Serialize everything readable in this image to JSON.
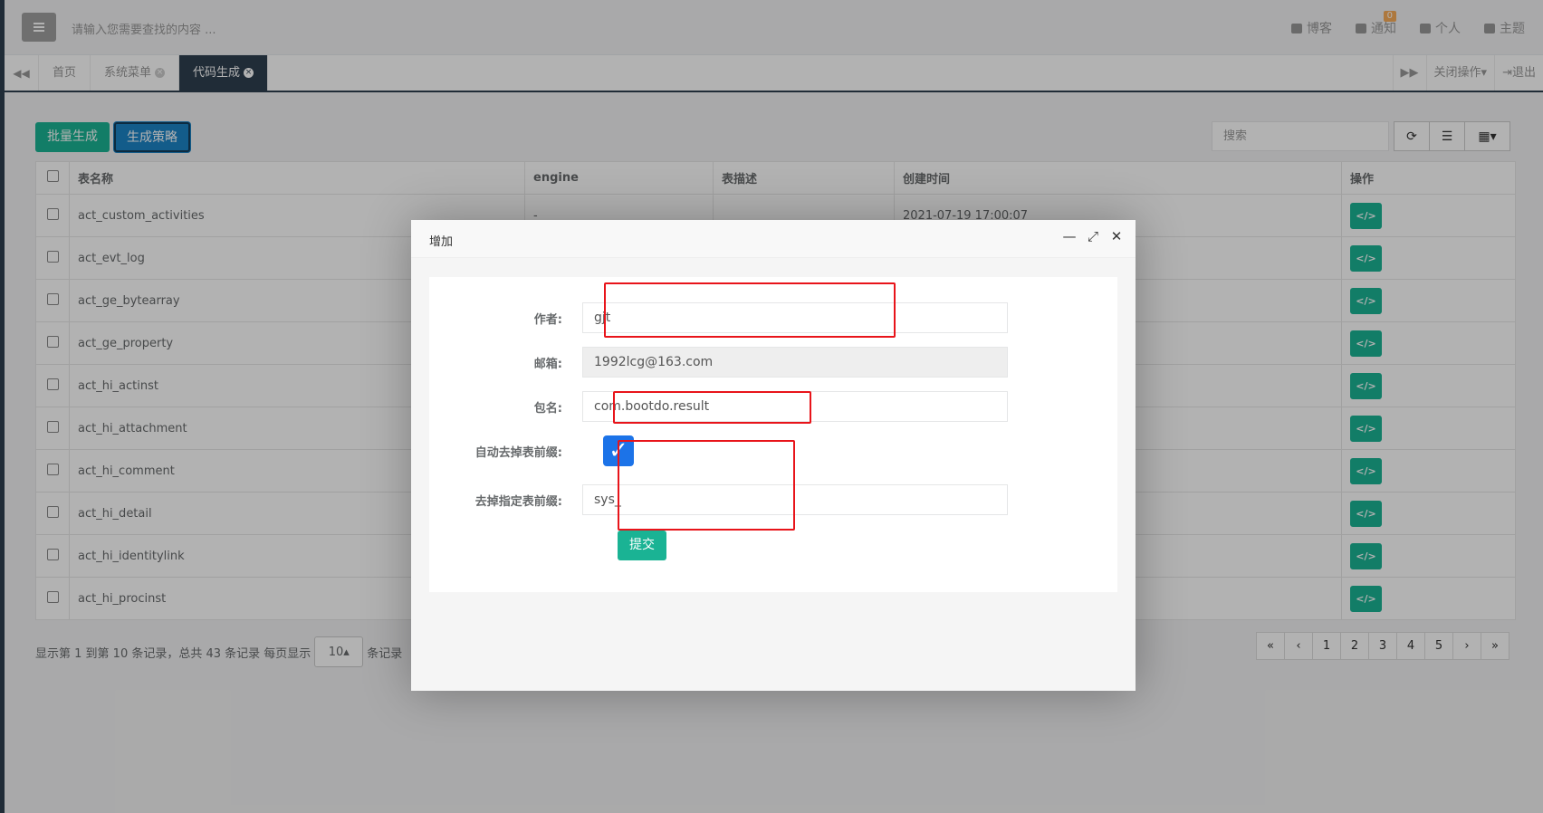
{
  "header": {
    "search_placeholder": "请输入您需要查找的内容 ...",
    "links": [
      {
        "icon": "rss-icon",
        "label": "博客"
      },
      {
        "icon": "envelope-icon",
        "label": "通知",
        "badge": "0"
      },
      {
        "icon": "id-card-icon",
        "label": "个人"
      },
      {
        "icon": "theme-icon",
        "label": "主题"
      }
    ]
  },
  "tabs": {
    "items": [
      {
        "label": "首页"
      },
      {
        "label": "系统菜单"
      },
      {
        "label": "代码生成"
      }
    ],
    "close_ops": "关闭操作",
    "logout": "退出"
  },
  "toolbar": {
    "batch_label": "批量生成",
    "strategy_label": "生成策略",
    "search_placeholder": "搜索"
  },
  "table": {
    "headers": [
      "表名称",
      "engine",
      "表描述",
      "创建时间",
      "操作"
    ],
    "rows": [
      {
        "name": "act_custom_activities",
        "engine": "-",
        "desc": "",
        "created": "2021-07-19 17:00:07"
      },
      {
        "name": "act_evt_log"
      },
      {
        "name": "act_ge_bytearray"
      },
      {
        "name": "act_ge_property"
      },
      {
        "name": "act_hi_actinst"
      },
      {
        "name": "act_hi_attachment"
      },
      {
        "name": "act_hi_comment"
      },
      {
        "name": "act_hi_detail"
      },
      {
        "name": "act_hi_identitylink"
      },
      {
        "name": "act_hi_procinst"
      }
    ],
    "op_label": "</>"
  },
  "pager": {
    "info": "显示第 1 到第 10 条记录，总共 43 条记录 每页显示",
    "size": "10",
    "suffix": "条记录",
    "pages": [
      "«",
      "‹",
      "1",
      "2",
      "3",
      "4",
      "5",
      "›",
      "»"
    ]
  },
  "modal": {
    "title": "增加",
    "fields": {
      "author_label": "作者:",
      "author_value": "gjt",
      "email_label": "邮箱:",
      "email_value": "1992lcg@163.com",
      "package_label": "包名:",
      "package_value": "com.bootdo.result",
      "auto_prefix_label": "自动去掉表前缀:",
      "prefix_label": "去掉指定表前缀:",
      "prefix_value": "sys_"
    },
    "submit_label": "提交"
  },
  "colors": {
    "primary": "#1ab394",
    "info": "#1c84c6",
    "navy": "#2f4050",
    "highlight": "#e8141a"
  }
}
